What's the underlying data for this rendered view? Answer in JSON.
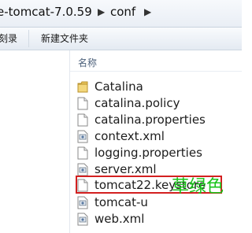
{
  "address_bar": {
    "segments": [
      "e-tomcat-7.0.59",
      "conf"
    ]
  },
  "toolbar": {
    "left_label": "刻录",
    "new_folder_label": "新建文件夹"
  },
  "file_list": {
    "column_header": "名称",
    "items": [
      {
        "name": "Catalina",
        "icon": "folder-icon"
      },
      {
        "name": "catalina.policy",
        "icon": "file-icon"
      },
      {
        "name": "catalina.properties",
        "icon": "file-icon"
      },
      {
        "name": "context.xml",
        "icon": "xml-file-icon"
      },
      {
        "name": "logging.properties",
        "icon": "file-icon"
      },
      {
        "name": "server.xml",
        "icon": "xml-file-icon"
      },
      {
        "name": "tomcat22.keystore",
        "icon": "file-icon",
        "highlighted": true
      },
      {
        "name": "tomcat-u",
        "icon": "xml-file-icon"
      },
      {
        "name": "web.xml",
        "icon": "xml-file-icon"
      }
    ]
  },
  "annotation": {
    "text": "草绿色",
    "color": "#19c41a"
  },
  "colors": {
    "highlight_border": "#d32020",
    "folder": "#e8c35a"
  }
}
